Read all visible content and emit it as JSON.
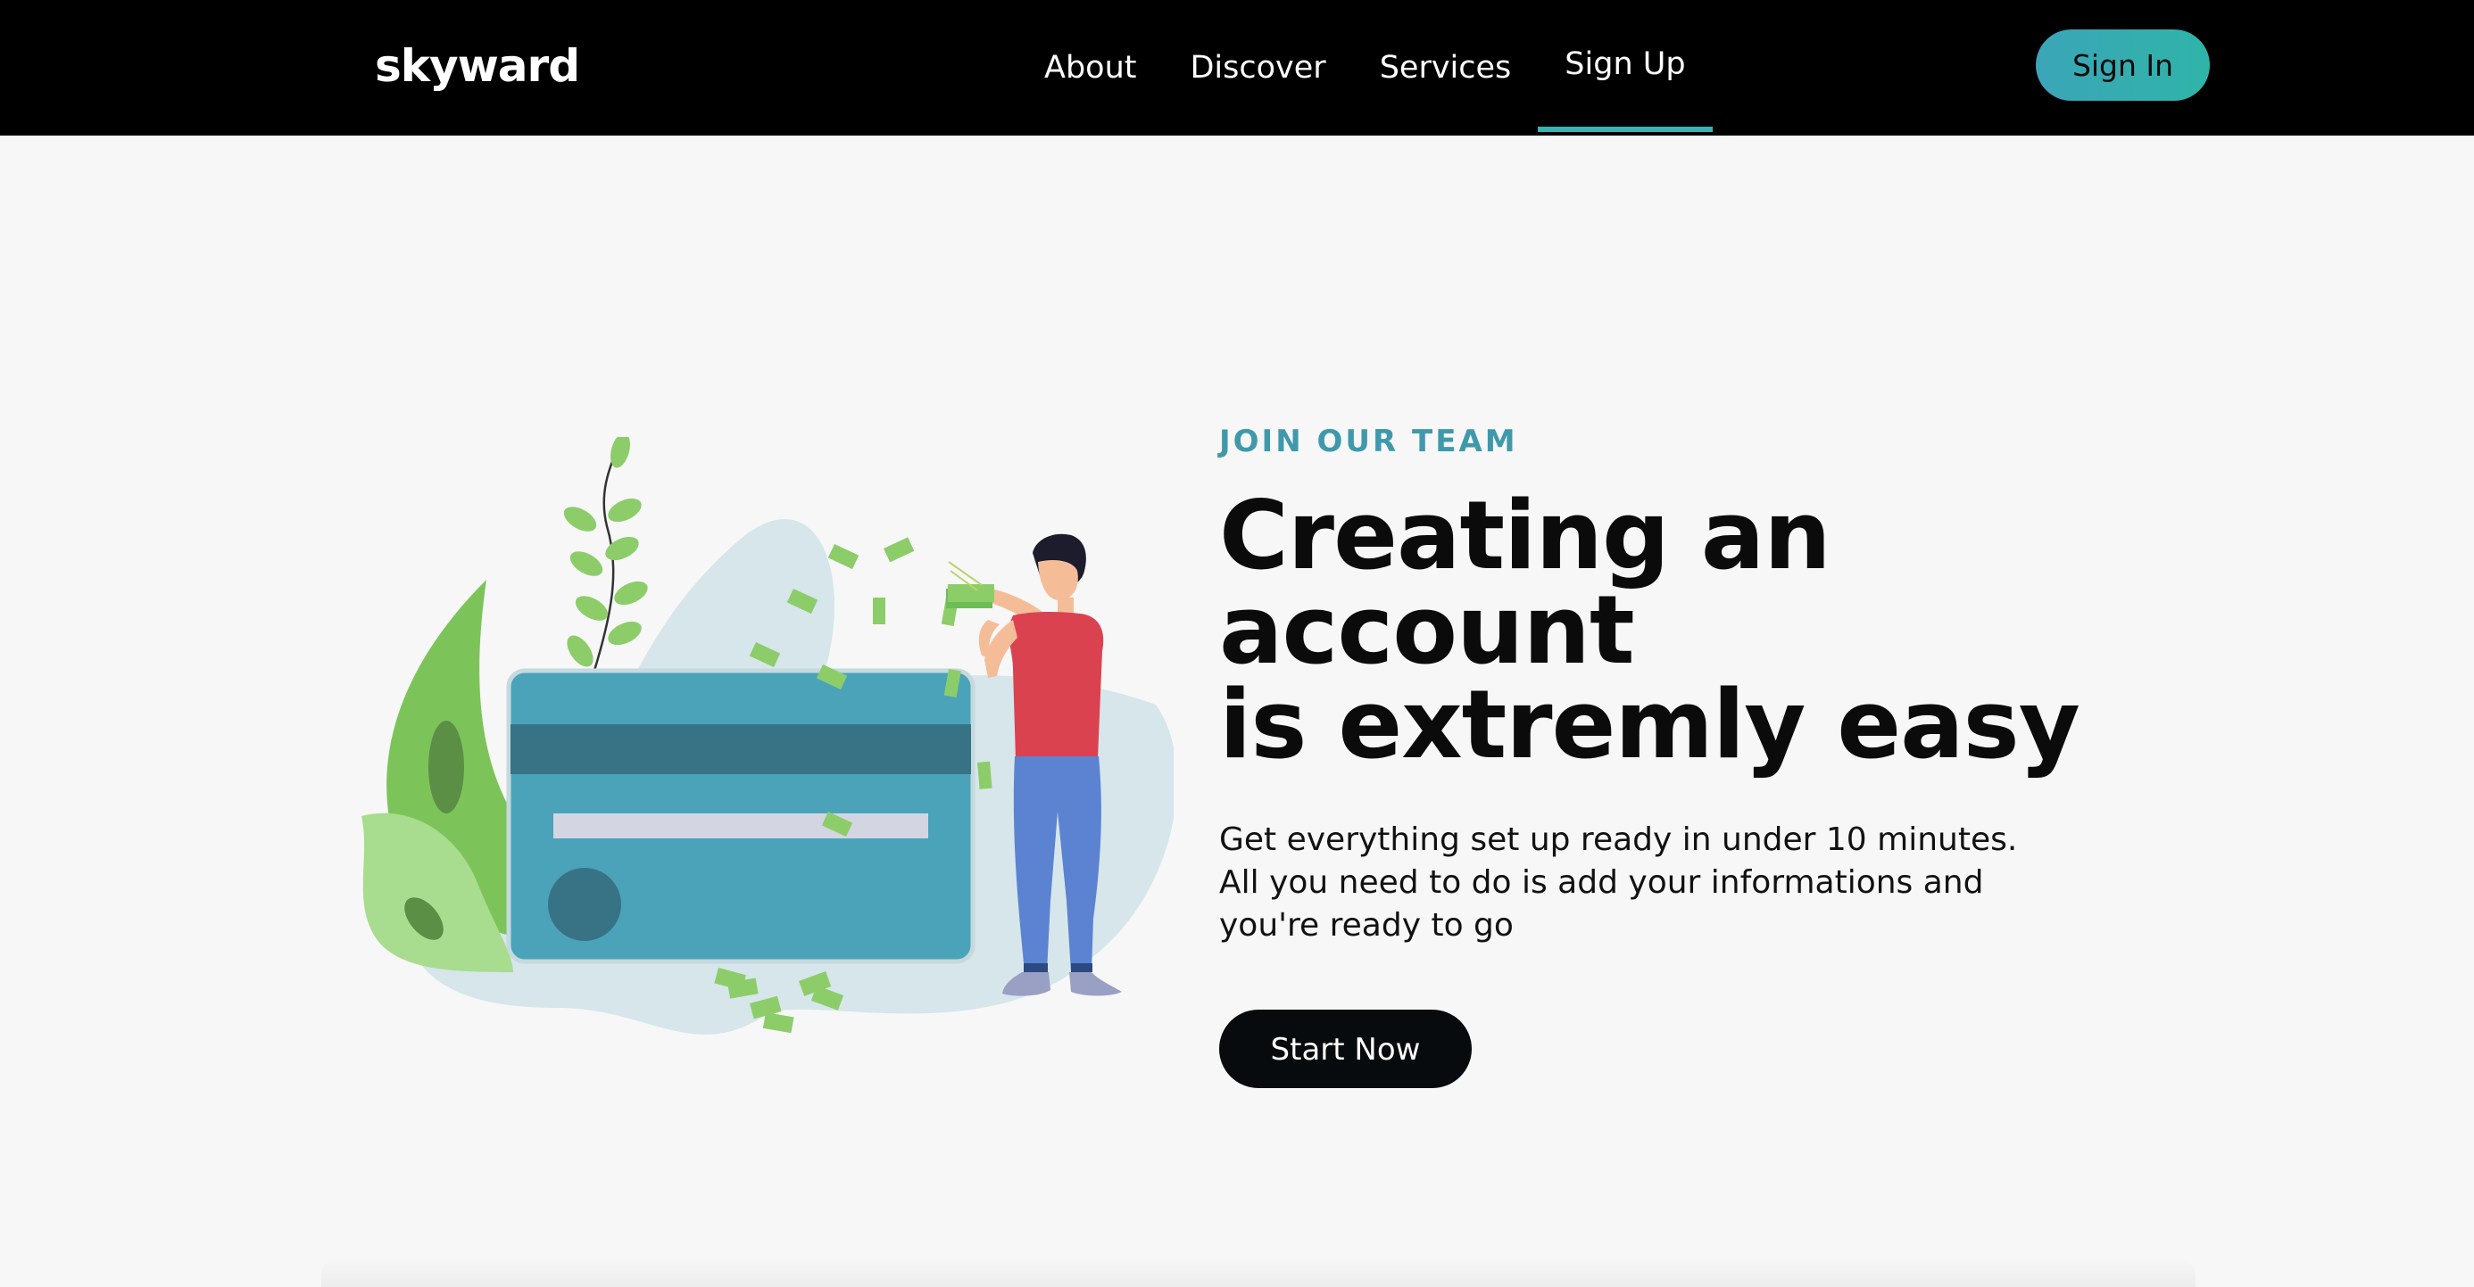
{
  "nav": {
    "logo": "skyward",
    "links": [
      {
        "label": "About"
      },
      {
        "label": "Discover"
      },
      {
        "label": "Services"
      },
      {
        "label": "Sign Up"
      }
    ],
    "signin_label": "Sign In",
    "accent": "#3bb3b3"
  },
  "hero": {
    "eyebrow": "JOIN OUR TEAM",
    "headline_line1": "Creating an account",
    "headline_line2": "is extremly easy",
    "description_line1": "Get everything set up ready in under 10 minutes.",
    "description_line2": "All you need to do is add your informations and",
    "description_line3": "you're ready to go",
    "cta_label": "Start Now"
  },
  "colors": {
    "nav_bg": "#000000",
    "page_bg": "#f7f7f7",
    "eyebrow": "#3f99ab",
    "card": "#4ba3b9",
    "card_stripe": "#387385",
    "leaf": "#8ccd6a",
    "shirt": "#db4250",
    "pants": "#5b83d1"
  },
  "icons": {
    "illustration": "credit-card-money-illustration"
  }
}
